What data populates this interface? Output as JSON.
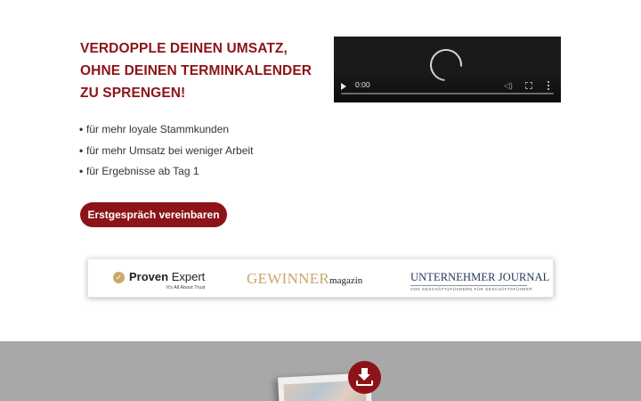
{
  "hero": {
    "title_lead": "VERDOPPLE DEINEN UMSATZ",
    "title_rest": ", OHNE DEINEN TERMINKALENDER ZU SPRENGEN!",
    "bullets": [
      "für mehr loyale Stammkunden",
      "für mehr Umsatz bei weniger Arbeit",
      "für Ergebnisse ab Tag 1"
    ],
    "bullet_marker": "•",
    "cta_label": "Erstgespräch vereinbaren"
  },
  "video": {
    "time": "0:00",
    "state": "loading"
  },
  "logos": {
    "proven_expert": {
      "name_bold": "Proven",
      "name_rest": " Expert",
      "tagline": "It's All About Trust"
    },
    "gewinner": {
      "big": "GEWINNER",
      "small": "magazin"
    },
    "unternehmer_journal": {
      "main": "UNTERNEHMER JOURNAL",
      "sub": "VON GESCHÄFTSFÜHRERN FÜR GESCHÄFTSFÜHRER"
    }
  },
  "download": {
    "icon": "download-icon"
  },
  "colors": {
    "brand": "#8c1418",
    "band": "#a8a8a8",
    "gold": "#c7a66e",
    "navy": "#1f3553"
  }
}
